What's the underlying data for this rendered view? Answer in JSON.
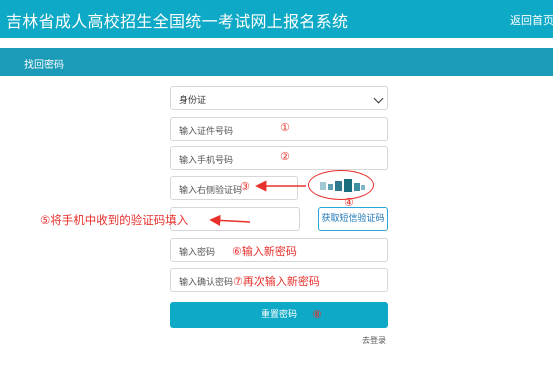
{
  "header": {
    "title": "吉林省成人高校招生全国统一考试网上报名系统",
    "home_link": "返回首页"
  },
  "subheader": {
    "title": "找回密码"
  },
  "form": {
    "id_type_selected": "身份证",
    "id_number_placeholder": "输入证件号码",
    "phone_placeholder": "输入手机号码",
    "captcha_placeholder": "输入右侧验证码",
    "sms_code_placeholder": "",
    "new_password_placeholder": "输入密码",
    "confirm_password_placeholder": "输入确认密码",
    "sms_button": "获取短信验证码",
    "reset_button": "重置密码",
    "login_link": "去登录"
  },
  "annotations": {
    "step1": "①",
    "step2": "②",
    "step3": "③",
    "step4": "④",
    "step5": "⑤将手机中收到的验证码填入",
    "step6": "⑥输入新密码",
    "step7": "⑦再次输入新密码",
    "step8": "⑧"
  },
  "colors": {
    "header_bg": "#0ea9c6",
    "subheader_bg": "#1b9bb8",
    "annotation_red": "#e8302c",
    "button_bg": "#0ea9c6"
  }
}
